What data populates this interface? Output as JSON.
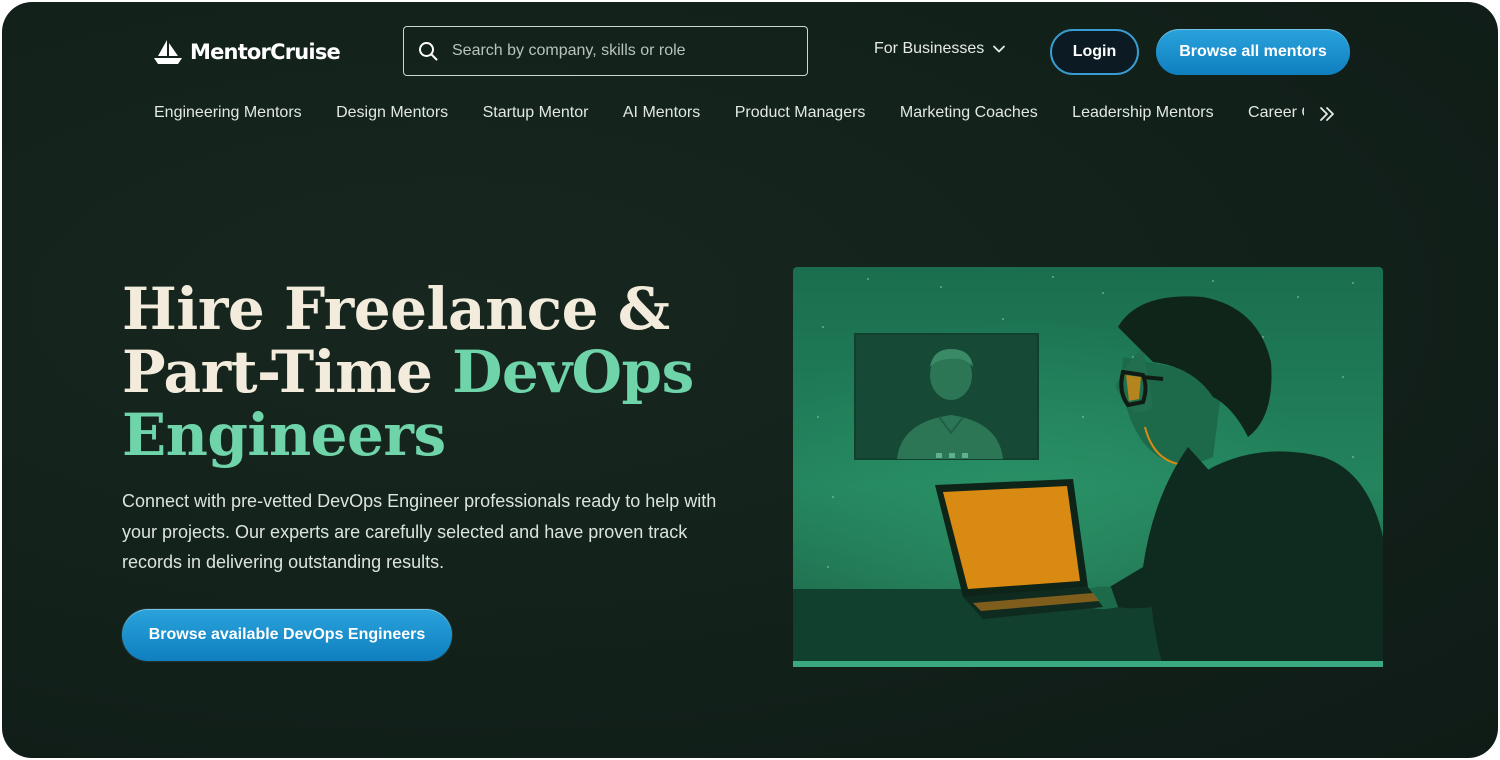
{
  "header": {
    "logo_text": "MentorCruise",
    "search_placeholder": "Search by company, skills or role",
    "for_businesses": "For Businesses",
    "login": "Login",
    "browse_all": "Browse all mentors"
  },
  "categories": [
    "Engineering Mentors",
    "Design Mentors",
    "Startup Mentor",
    "AI Mentors",
    "Product Managers",
    "Marketing Coaches",
    "Leadership Mentors",
    "Career Coaches"
  ],
  "hero": {
    "title_line1": "Hire Freelance &",
    "title_line2_plain": "Part-Time ",
    "title_line2_accent": "DevOps",
    "title_line3_accent": "Engineers",
    "description": "Connect with pre-vetted DevOps Engineer professionals ready to help with your projects. Our experts are carefully selected and have proven track records in delivering outstanding results.",
    "cta": "Browse available DevOps Engineers"
  },
  "colors": {
    "background": "#12201a",
    "title": "#f3ecdc",
    "accent": "#6fd4a9",
    "button": "#1a8fcc",
    "illustration_green": "#1f7a58",
    "laptop_screen": "#d98a12"
  },
  "icons": {
    "logo": "sailboat-icon",
    "search": "search-icon",
    "dropdown": "chevron-down-icon",
    "more": "double-chevron-right-icon"
  }
}
